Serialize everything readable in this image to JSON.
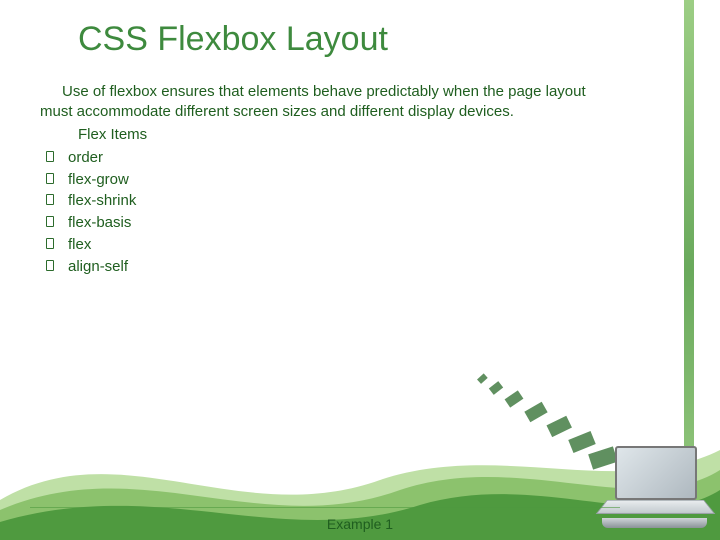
{
  "title": "CSS Flexbox Layout",
  "intro": "Use of flexbox ensures that elements behave predictably when the page layout must accommodate different screen sizes and different display devices.",
  "subhead": "Flex Items",
  "items": [
    "order",
    "flex-grow",
    "flex-shrink",
    "flex-basis",
    "flex",
    "align-self"
  ],
  "footer": "Example 1"
}
